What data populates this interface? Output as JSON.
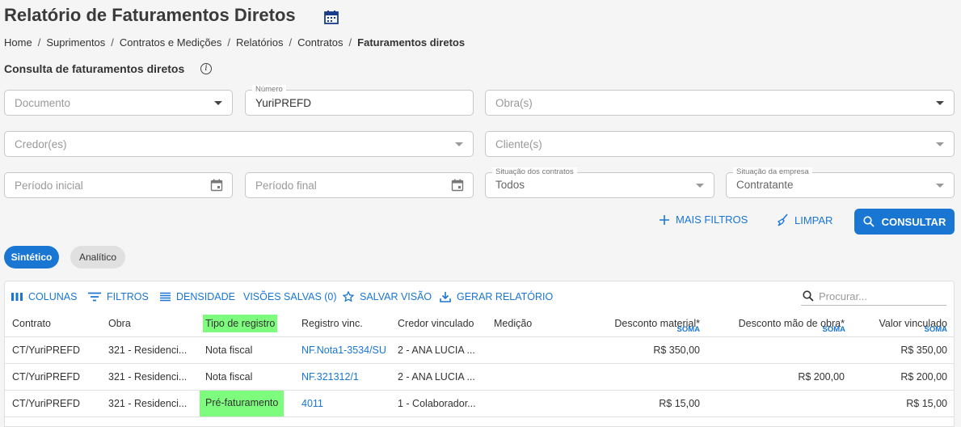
{
  "page": {
    "title": "Relatório de Faturamentos Diretos",
    "breadcrumb": [
      "Home",
      "Suprimentos",
      "Contratos e Medições",
      "Relatórios",
      "Contratos",
      "Faturamentos diretos"
    ],
    "subtitle": "Consulta de faturamentos diretos"
  },
  "filters": {
    "documento": {
      "placeholder": "Documento"
    },
    "numero": {
      "label": "Número",
      "value": "YuriPREFD"
    },
    "obras": {
      "placeholder": "Obra(s)"
    },
    "credores": {
      "placeholder": "Credor(es)"
    },
    "clientes": {
      "placeholder": "Cliente(s)"
    },
    "periodo_inicial": {
      "placeholder": "Período inicial"
    },
    "periodo_final": {
      "placeholder": "Período final"
    },
    "situacao_contratos": {
      "label": "Situação dos contratos",
      "value": "Todos"
    },
    "situacao_empresa": {
      "label": "Situação da empresa",
      "value": "Contratante"
    }
  },
  "actions": {
    "mais_filtros": "MAIS FILTROS",
    "limpar": "LIMPAR",
    "consultar": "CONSULTAR"
  },
  "views": {
    "sintetico": "Sintético",
    "analitico": "Analítico",
    "selected": "Sintético"
  },
  "toolbar": {
    "colunas": "COLUNAS",
    "filtros": "FILTROS",
    "densidade": "DENSIDADE",
    "visoes_salvas": "VISÕES SALVAS (0)",
    "salvar_visao": "SALVAR VISÃO",
    "gerar_relatorio": "GERAR RELATÓRIO",
    "search_placeholder": "Procurar..."
  },
  "table": {
    "columns": {
      "contrato": "Contrato",
      "obra": "Obra",
      "tipo": "Tipo de registro",
      "registro": "Registro vinc.",
      "credor": "Credor vinculado",
      "medicao": "Medição",
      "desc_material": "Desconto material*",
      "desc_mao_obra": "Desconto mão de obra*",
      "valor": "Valor vinculado",
      "soma": "SOMA"
    },
    "rows": [
      {
        "contrato": "CT/YuriPREFD",
        "obra": "321 - Residenci...",
        "tipo": "Nota fiscal",
        "registro": "NF.Nota1-3534/SU",
        "credor": "2 - ANA LUCIA ...",
        "medicao": "",
        "desc_material": "R$ 350,00",
        "desc_mao_obra": "",
        "valor": "R$ 350,00"
      },
      {
        "contrato": "CT/YuriPREFD",
        "obra": "321 - Residenci...",
        "tipo": "Nota fiscal",
        "registro": "NF.321312/1",
        "credor": "2 - ANA LUCIA ...",
        "medicao": "",
        "desc_material": "",
        "desc_mao_obra": "R$ 200,00",
        "valor": "R$ 200,00"
      },
      {
        "contrato": "CT/YuriPREFD",
        "obra": "321 - Residenci...",
        "tipo": "Pré-faturamento",
        "registro": "4011",
        "credor": "1 - Colaborador...",
        "medicao": "",
        "desc_material": "R$ 15,00",
        "desc_mao_obra": "",
        "valor": "R$ 15,00"
      }
    ]
  },
  "colors": {
    "accent": "#1976d2",
    "highlight": "#7dfc7d"
  }
}
